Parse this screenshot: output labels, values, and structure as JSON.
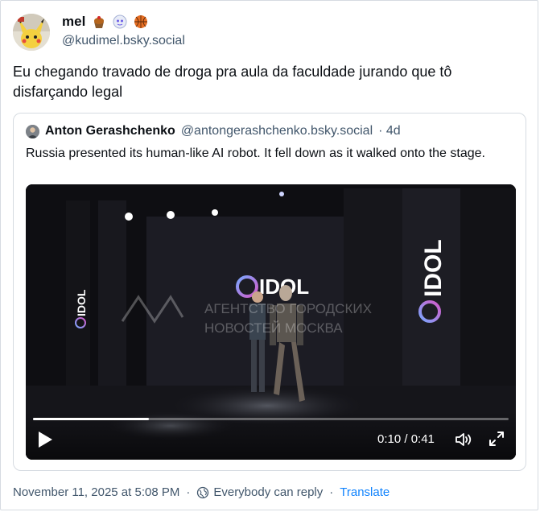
{
  "post": {
    "display_name": "mel",
    "name_emojis": [
      "cupcake-emoji",
      "ghost-emoji",
      "basketball-emoji"
    ],
    "handle": "@kudimel.bsky.social",
    "text": "Eu chegando travado de droga pra aula  da faculdade jurando que tô disfarçando legal"
  },
  "quote": {
    "display_name": "Anton Gerashchenko",
    "handle": "@antongerashchenko.bsky.social",
    "age": "· 4d",
    "text": "Russia presented its human-like AI robot. It fell down as it walked onto the stage."
  },
  "video": {
    "brand_text_center": "IDOL",
    "brand_text_left": "IDOL",
    "brand_text_right": "IDOL",
    "watermark_line1": "АГЕНТСТВО ГОРОДСКИХ",
    "watermark_line2": "НОВОСТЕЙ МОСКВА",
    "time": "0:10 / 0:41",
    "progress_fraction": 0.244,
    "icons": [
      "play-icon",
      "volume-icon",
      "fullscreen-icon"
    ]
  },
  "footer": {
    "date": "November 11, 2025 at 5:08 PM",
    "separator": "·",
    "reply_setting": "Everybody can reply",
    "translate_label": "Translate"
  },
  "colors": {
    "text": "#0b0f14",
    "muted": "#42576c",
    "link": "#1083fe",
    "border": "#d6dbe1"
  }
}
